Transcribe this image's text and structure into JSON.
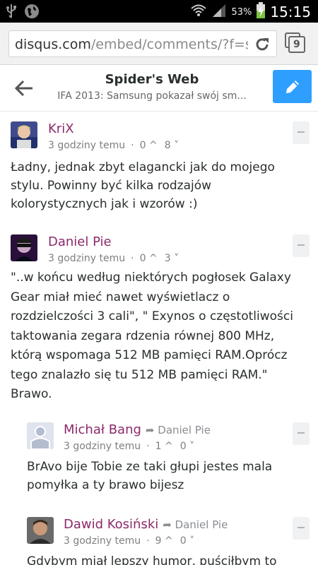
{
  "status_bar": {
    "battery_percent": "53%",
    "time": "15:15",
    "icons": [
      "usb-icon",
      "globe-icon",
      "wifi-icon",
      "signal-icon",
      "battery-charging-icon"
    ]
  },
  "browser": {
    "url_domain": "disqus.com",
    "url_path": "/embed/comments/?f=spid",
    "tab_count": "9"
  },
  "header": {
    "title": "Spider's Web",
    "subtitle": "IFA 2013: Samsung pokazał swój sm..."
  },
  "comments": [
    {
      "author": "KriX",
      "time": "3 godziny temu",
      "upvotes": "0",
      "downvotes": "8",
      "text": "Ładny, jednak zbyt elagancki jak do mojego stylu. Powinny być kilka rodzajów kolorystycznych jak i wzorów :)"
    },
    {
      "author": "Daniel Pie",
      "time": "3 godziny temu",
      "upvotes": "0",
      "downvotes": "3",
      "text": "\"..w końcu według niektórych pogłosek Galaxy Gear miał mieć nawet wyświetlacz o rozdzielczości 3 cali\", \" Exynos o częstotliwości taktowania zegara rdzenia równej 800 MHz, którą wspomaga 512 MB pamięci RAM.Oprócz tego znalazło się tu 512 MB pamięci RAM.\" Brawo."
    },
    {
      "author": "Michał Bang",
      "reply_to": "Daniel Pie",
      "time": "3 godziny temu",
      "upvotes": "1",
      "downvotes": "0",
      "text": "BrAvo bije Tobie ze taki głupi jestes mala pomyłka a ty brawo bijesz"
    },
    {
      "author": "Dawid Kosiński",
      "reply_to": "Daniel Pie",
      "time": "3 godziny temu",
      "upvotes": "9",
      "downvotes": "0",
      "text": "Gdybym miał lepszy humor, puściłbym to"
    }
  ]
}
